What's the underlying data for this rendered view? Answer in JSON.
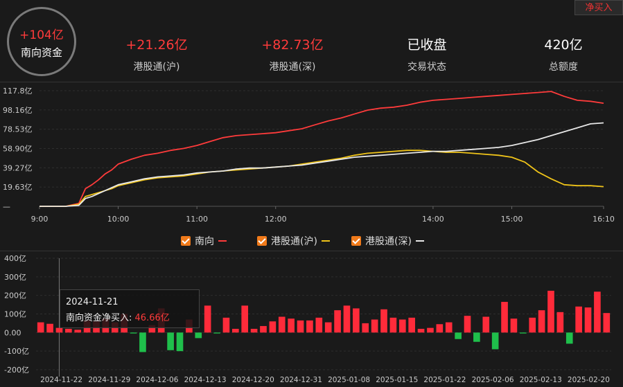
{
  "top_button": "净买入",
  "summary": {
    "total": "+104亿",
    "total_label": "南向资金",
    "stats": [
      {
        "value": "+21.26亿",
        "label": "港股通(沪)",
        "color": "#ff3b3b"
      },
      {
        "value": "+82.73亿",
        "label": "港股通(深)",
        "color": "#ff3b3b"
      },
      {
        "value": "已收盘",
        "label": "交易状态",
        "color": "#ffffff"
      },
      {
        "value": "420亿",
        "label": "总额度",
        "color": "#ffffff"
      }
    ]
  },
  "legend": [
    {
      "label": "南向",
      "color": "#ff3b3b"
    },
    {
      "label": "港股通(沪)",
      "color": "#f0c419"
    },
    {
      "label": "港股通(深)",
      "color": "#e8e8e8"
    }
  ],
  "tooltip": {
    "date": "2024-11-21",
    "label": "南向资金净买入:",
    "value": "46.66亿"
  },
  "chart_data": [
    {
      "type": "line",
      "x": [
        "9:00",
        "9:20",
        "9:30",
        "9:35",
        "9:40",
        "9:45",
        "9:50",
        "9:55",
        "10:00",
        "10:10",
        "10:20",
        "10:30",
        "10:40",
        "10:50",
        "11:00",
        "11:10",
        "11:20",
        "11:30",
        "11:40",
        "11:50",
        "12:00",
        "12:10",
        "12:20",
        "12:30",
        "12:40",
        "12:50",
        "13:00",
        "13:10",
        "13:20",
        "13:30",
        "13:40",
        "13:50",
        "14:00",
        "14:10",
        "14:20",
        "14:30",
        "14:40",
        "14:50",
        "15:00",
        "15:10",
        "15:20",
        "15:30",
        "15:40",
        "15:50",
        "16:00",
        "16:10"
      ],
      "x_ticks": [
        "9:00",
        "10:00",
        "11:00",
        "12:00",
        "14:00",
        "15:00",
        "16:10"
      ],
      "y_ticks": [
        "117.8亿",
        "98.16亿",
        "78.53亿",
        "58.90亿",
        "39.27亿",
        "19.63亿",
        "—"
      ],
      "ylim": [
        0,
        117.8
      ],
      "series": [
        {
          "name": "南向",
          "color": "#ff3b3b",
          "values": [
            0,
            0,
            3,
            18,
            22,
            27,
            33,
            37,
            43,
            48,
            52,
            54,
            57,
            59,
            62,
            66,
            70,
            72,
            73,
            74,
            75,
            77,
            79,
            83,
            87,
            90,
            94,
            98,
            100,
            101,
            103,
            106,
            108,
            109,
            110,
            111,
            112,
            113,
            114,
            115,
            116,
            117,
            112,
            108,
            107,
            105
          ]
        },
        {
          "name": "港股通(沪)",
          "color": "#f0c419",
          "values": [
            0,
            0,
            2,
            10,
            12,
            14,
            16,
            18,
            21,
            24,
            27,
            29,
            30,
            31,
            33,
            35,
            36,
            37,
            38,
            39,
            40,
            41,
            43,
            45,
            47,
            49,
            52,
            54,
            55,
            56,
            57,
            57,
            56,
            55,
            55,
            54,
            53,
            52,
            50,
            45,
            35,
            28,
            22,
            21,
            21,
            20
          ]
        },
        {
          "name": "港股通(深)",
          "color": "#e8e8e8",
          "values": [
            0,
            0,
            1,
            8,
            10,
            13,
            16,
            19,
            22,
            25,
            28,
            30,
            31,
            32,
            34,
            35,
            36,
            38,
            39,
            39,
            40,
            41,
            42,
            44,
            46,
            48,
            50,
            51,
            52,
            53,
            54,
            55,
            56,
            56,
            57,
            58,
            59,
            60,
            62,
            65,
            68,
            72,
            76,
            80,
            84,
            85
          ]
        }
      ]
    },
    {
      "type": "bar",
      "y_ticks": [
        "400亿",
        "300亿",
        "200亿",
        "100亿",
        "0.00",
        "-100亿",
        "-200亿"
      ],
      "ylim": [
        -200,
        400
      ],
      "x_ticks": [
        "2024-11-22",
        "2024-11-29",
        "2024-12-06",
        "2024-12-13",
        "2024-12-20",
        "2024-12-31",
        "2025-01-08",
        "2025-01-15",
        "2025-01-22",
        "2025-02-06",
        "2025-02-13",
        "2025-02-20"
      ],
      "series": [
        {
          "name": "南向资金净买入",
          "values": [
            55,
            47,
            25,
            20,
            15,
            65,
            60,
            75,
            55,
            100,
            -5,
            -105,
            40,
            130,
            -95,
            -100,
            70,
            -30,
            145,
            -5,
            80,
            20,
            145,
            20,
            35,
            60,
            85,
            75,
            65,
            65,
            80,
            55,
            120,
            145,
            130,
            50,
            70,
            125,
            80,
            70,
            80,
            20,
            25,
            45,
            55,
            -35,
            90,
            -50,
            85,
            -90,
            165,
            75,
            -5,
            80,
            120,
            225,
            110,
            -60,
            140,
            135,
            220,
            105
          ]
        }
      ]
    }
  ]
}
